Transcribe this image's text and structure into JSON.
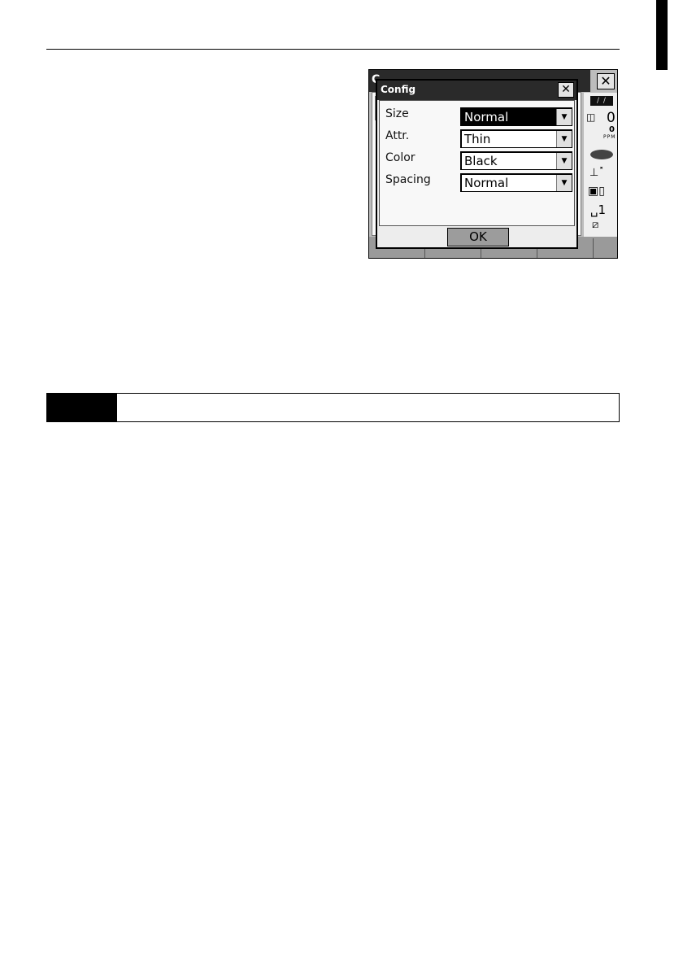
{
  "dialog": {
    "title": "Config",
    "close_glyph": "✕",
    "rows": [
      {
        "label": "Size",
        "value": "Normal",
        "selected": true
      },
      {
        "label": "Attr.",
        "value": "Thin",
        "selected": false
      },
      {
        "label": "Color",
        "value": "Black",
        "selected": false
      },
      {
        "label": "Spacing",
        "value": "Normal",
        "selected": false
      }
    ],
    "ok_label": "OK",
    "dropdown_arrow": "▼"
  },
  "background_window": {
    "title_fragment": "C",
    "close_glyph": "✕"
  },
  "status": {
    "prism_constant": "0",
    "ppm_value": "0",
    "ppm_label": "PPM",
    "face_number": "1"
  },
  "icons": {
    "battery": "battery-icon",
    "prism": "prism-icon",
    "laser": "laser-eye-icon",
    "tilt": "tilt-icon",
    "communication": "communication-icon",
    "input_mode": "keyboard-icon"
  },
  "colors": {
    "title_bar": "#2a2a2a",
    "selection": "#000000",
    "ok_button": "#9c9c9c",
    "screen_bg": "#bdbdbd"
  }
}
